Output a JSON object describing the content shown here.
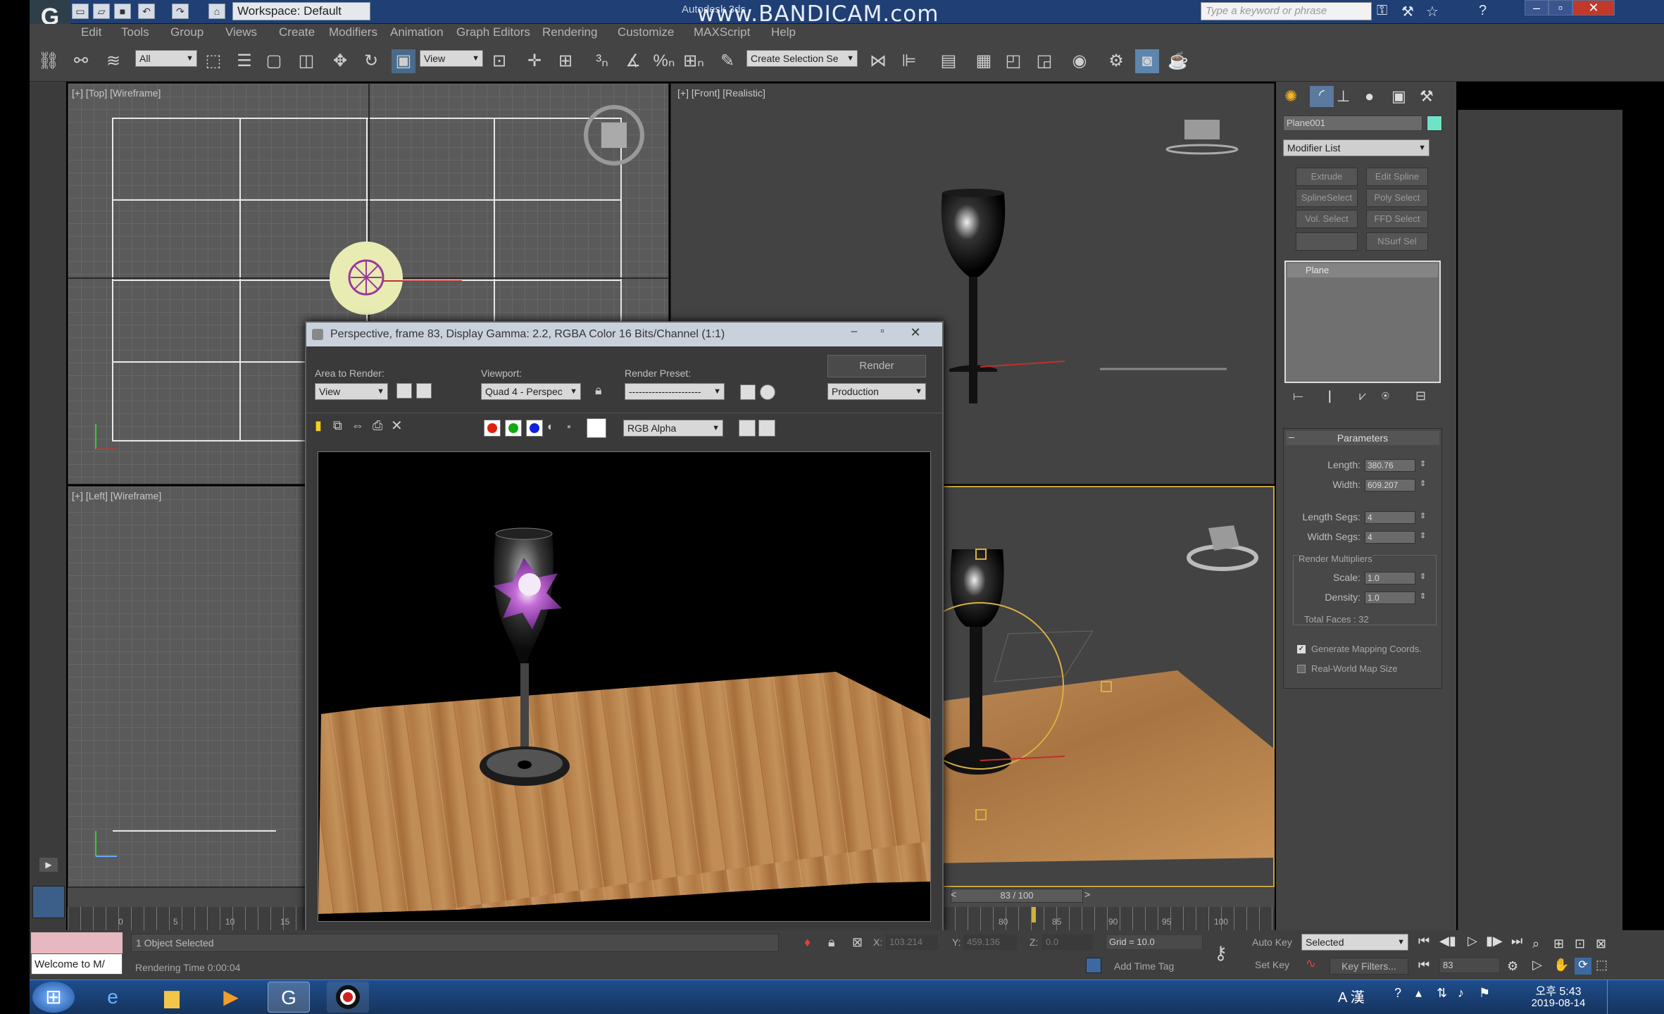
{
  "titlebar": {
    "workspace_label": "Workspace: Default",
    "app_title": "Autodesk 3ds",
    "watermark": "www.BANDICAM.com",
    "search_placeholder": "Type a keyword or phrase"
  },
  "menu": [
    "Edit",
    "Tools",
    "Group",
    "Views",
    "Create",
    "Modifiers",
    "Animation",
    "Graph Editors",
    "Rendering",
    "Customize",
    "MAXScript",
    "Help"
  ],
  "toolbar": {
    "selection_filter": "All",
    "reference_coord": "View",
    "named_selection": "Create Selection Se"
  },
  "viewports": {
    "top_label": "[+] [Top] [Wireframe]",
    "front_label": "[+] [Front] [Realistic]",
    "left_label": "[+] [Left] [Wireframe]"
  },
  "render_window": {
    "title": "Perspective, frame 83, Display Gamma: 2.2, RGBA Color 16 Bits/Channel (1:1)",
    "area_label": "Area to Render:",
    "area_value": "View",
    "viewport_label": "Viewport:",
    "viewport_value": "Quad 4 - Perspec",
    "preset_label": "Render Preset:",
    "preset_value": "----------------------",
    "render_button": "Render",
    "production_value": "Production",
    "channel_value": "RGB Alpha"
  },
  "command_panel": {
    "object_name": "Plane001",
    "object_color": "#6fe3c5",
    "modifier_list": "Modifier List",
    "modifier_buttons": [
      "Extrude",
      "Edit Spline",
      "SplineSelect",
      "Poly Select",
      "Vol. Select",
      "FFD Select",
      "",
      "NSurf Sel"
    ],
    "stack_item": "Plane",
    "rollout_title": "Parameters",
    "params": [
      {
        "label": "Length:",
        "value": "380.76"
      },
      {
        "label": "Width:",
        "value": "609.207"
      },
      {
        "label": "Length Segs:",
        "value": "4"
      },
      {
        "label": "Width Segs:",
        "value": "4"
      }
    ],
    "render_multipliers": "Render Multipliers",
    "multipliers": [
      {
        "label": "Scale:",
        "value": "1.0"
      },
      {
        "label": "Density:",
        "value": "1.0"
      }
    ],
    "total_faces": "Total Faces : 32",
    "gen_mapping": "Generate Mapping Coords.",
    "real_world": "Real-World Map Size"
  },
  "timeline": {
    "frame_counter": "83 / 100",
    "ticks": [
      "0",
      "5",
      "10",
      "15",
      "80",
      "85",
      "90",
      "95",
      "100"
    ]
  },
  "status": {
    "maxscript_text": "Welcome to M/",
    "selected_text": "1 Object Selected",
    "render_time": "Rendering Time  0:00:04",
    "x_label": "X:",
    "x_value": "103.214",
    "y_label": "Y:",
    "y_value": "459.136",
    "z_label": "Z:",
    "z_value": "0.0",
    "grid": "Grid = 10.0",
    "add_time_tag": "Add Time Tag",
    "auto_key": "Auto Key",
    "set_key": "Set Key",
    "selected_dropdown": "Selected",
    "key_filters": "Key Filters...",
    "frame_field": "83"
  },
  "taskbar": {
    "clock_time": "오후 5:43",
    "clock_date": "2019-08-14",
    "ime": "A 漢"
  }
}
